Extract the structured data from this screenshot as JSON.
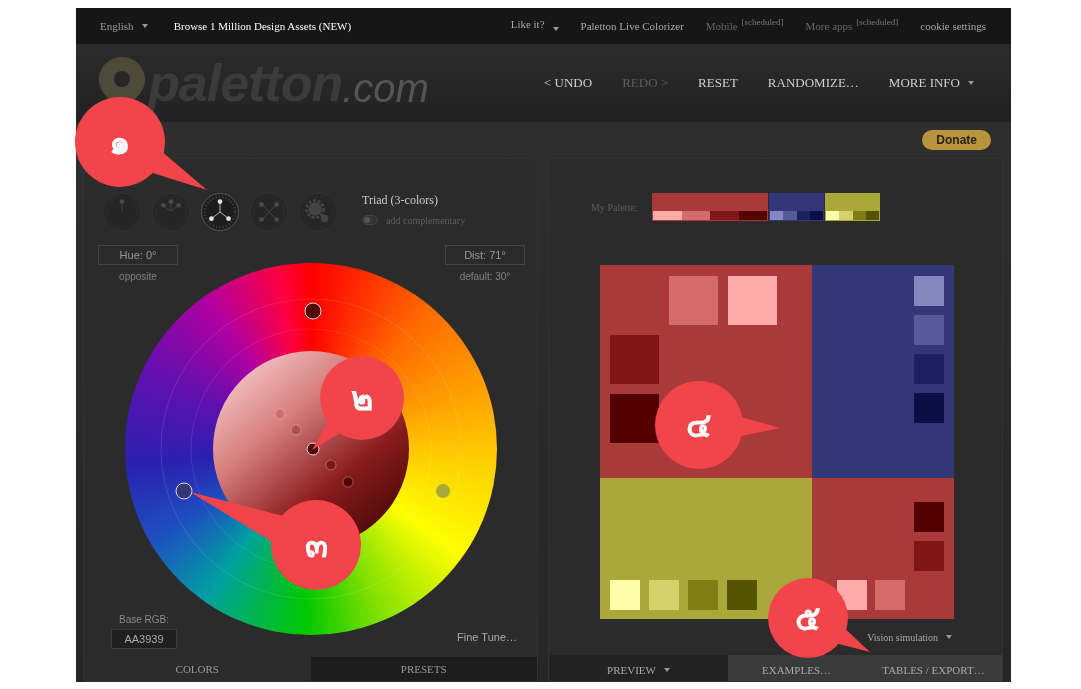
{
  "top_bar": {
    "left_links": [
      {
        "label": "English",
        "dropdown": true,
        "highlighted": false
      },
      {
        "label": "Browse 1 Million Design Assets (NEW)",
        "dropdown": false,
        "highlighted": true
      }
    ],
    "right_links": [
      {
        "label": "Like it?",
        "dropdown": true,
        "disabled": false
      },
      {
        "label": "Paletton Live Colorizer",
        "dropdown": false,
        "disabled": false
      },
      {
        "label": "Mobile",
        "tag": "[scheduled]",
        "dropdown": false,
        "disabled": true
      },
      {
        "label": "More apps",
        "tag": "[scheduled]",
        "dropdown": false,
        "disabled": true
      },
      {
        "label": "cookie settings",
        "dropdown": false,
        "disabled": false
      }
    ]
  },
  "header": {
    "logo": {
      "name": "paletton",
      "suffix": ".com"
    },
    "actions": [
      {
        "label": "< UNDO",
        "disabled": false,
        "dropdown": false
      },
      {
        "label": "REDO >",
        "disabled": true,
        "dropdown": false
      },
      {
        "label": "RESET",
        "disabled": false,
        "dropdown": false
      },
      {
        "label": "RANDOMIZE…",
        "disabled": false,
        "dropdown": false
      },
      {
        "label": "MORE INFO",
        "disabled": false,
        "dropdown": true
      }
    ]
  },
  "donate": "Donate",
  "left_panel": {
    "modes": [
      {
        "kind": "mono",
        "selected": false
      },
      {
        "kind": "adjacent",
        "selected": false
      },
      {
        "kind": "triad",
        "selected": true
      },
      {
        "kind": "tetrad",
        "selected": false
      },
      {
        "kind": "free",
        "selected": false
      }
    ],
    "scheme_name": "Triad (3-colors)",
    "complement": {
      "label": "add complementary",
      "on": false
    },
    "hue": {
      "value": "Hue: 0°",
      "hint": "opposite"
    },
    "dist": {
      "value": "Dist: 71°",
      "hint": "default: 30°"
    },
    "base_rgb": {
      "label": "Base RGB:",
      "value": "AA3939"
    },
    "fine_tune": "Fine Tune…",
    "tabs": [
      {
        "label": "COLORS",
        "selected": true
      },
      {
        "label": "PRESETS",
        "selected": false
      }
    ]
  },
  "right_panel": {
    "palette_label": "My Palette:",
    "palette": [
      {
        "color": "#aa3939",
        "shades": [
          {
            "color": "#ffaaaa"
          },
          {
            "color": "#d46a6a"
          },
          {
            "color": "#801515"
          },
          {
            "color": "#550000"
          }
        ]
      },
      {
        "color": "#333778",
        "shades": [
          {
            "color": "#8588bf"
          },
          {
            "color": "#575b99"
          },
          {
            "color": "#1d2060"
          },
          {
            "color": "#0b0d45"
          }
        ]
      },
      {
        "color": "#aaa839",
        "shades": [
          {
            "color": "#fffeaa"
          },
          {
            "color": "#d4d26a"
          },
          {
            "color": "#807d15"
          },
          {
            "color": "#555300"
          }
        ]
      }
    ],
    "preview": [
      {
        "color": "#aa3939",
        "swatches": [
          {
            "color": "#d46a6a"
          },
          {
            "color": "#ffaaaa"
          },
          {
            "color": "#801515"
          },
          {
            "color": "#550000"
          }
        ]
      },
      {
        "color": "#333778",
        "swatches": [
          {
            "color": "#8588bf"
          },
          {
            "color": "#575b99"
          },
          {
            "color": "#1d2060"
          },
          {
            "color": "#0b0d45"
          }
        ]
      },
      {
        "color": "#aaa839",
        "swatches": [
          {
            "color": "#fffeaa"
          },
          {
            "color": "#d4d26a"
          },
          {
            "color": "#807d15"
          },
          {
            "color": "#555300"
          }
        ]
      },
      {
        "color": "#aa3939",
        "swatches": [
          {
            "color": "#550000"
          },
          {
            "color": "#801515"
          },
          {
            "color": "#ffaaaa"
          },
          {
            "color": "#d46a6a"
          }
        ]
      }
    ],
    "vision": {
      "label": "Vision simulation",
      "dropdown": true
    },
    "tabs": [
      {
        "label": "PREVIEW",
        "selected": true,
        "dropdown": true
      },
      {
        "label": "EXAMPLES…",
        "selected": false,
        "dropdown": false
      },
      {
        "label": "TABLES / EXPORT…",
        "selected": false,
        "dropdown": false
      }
    ]
  },
  "callouts": [
    {
      "label": "๑"
    },
    {
      "label": "๒"
    },
    {
      "label": "๓"
    },
    {
      "label": "๔"
    },
    {
      "label": "๕"
    }
  ]
}
